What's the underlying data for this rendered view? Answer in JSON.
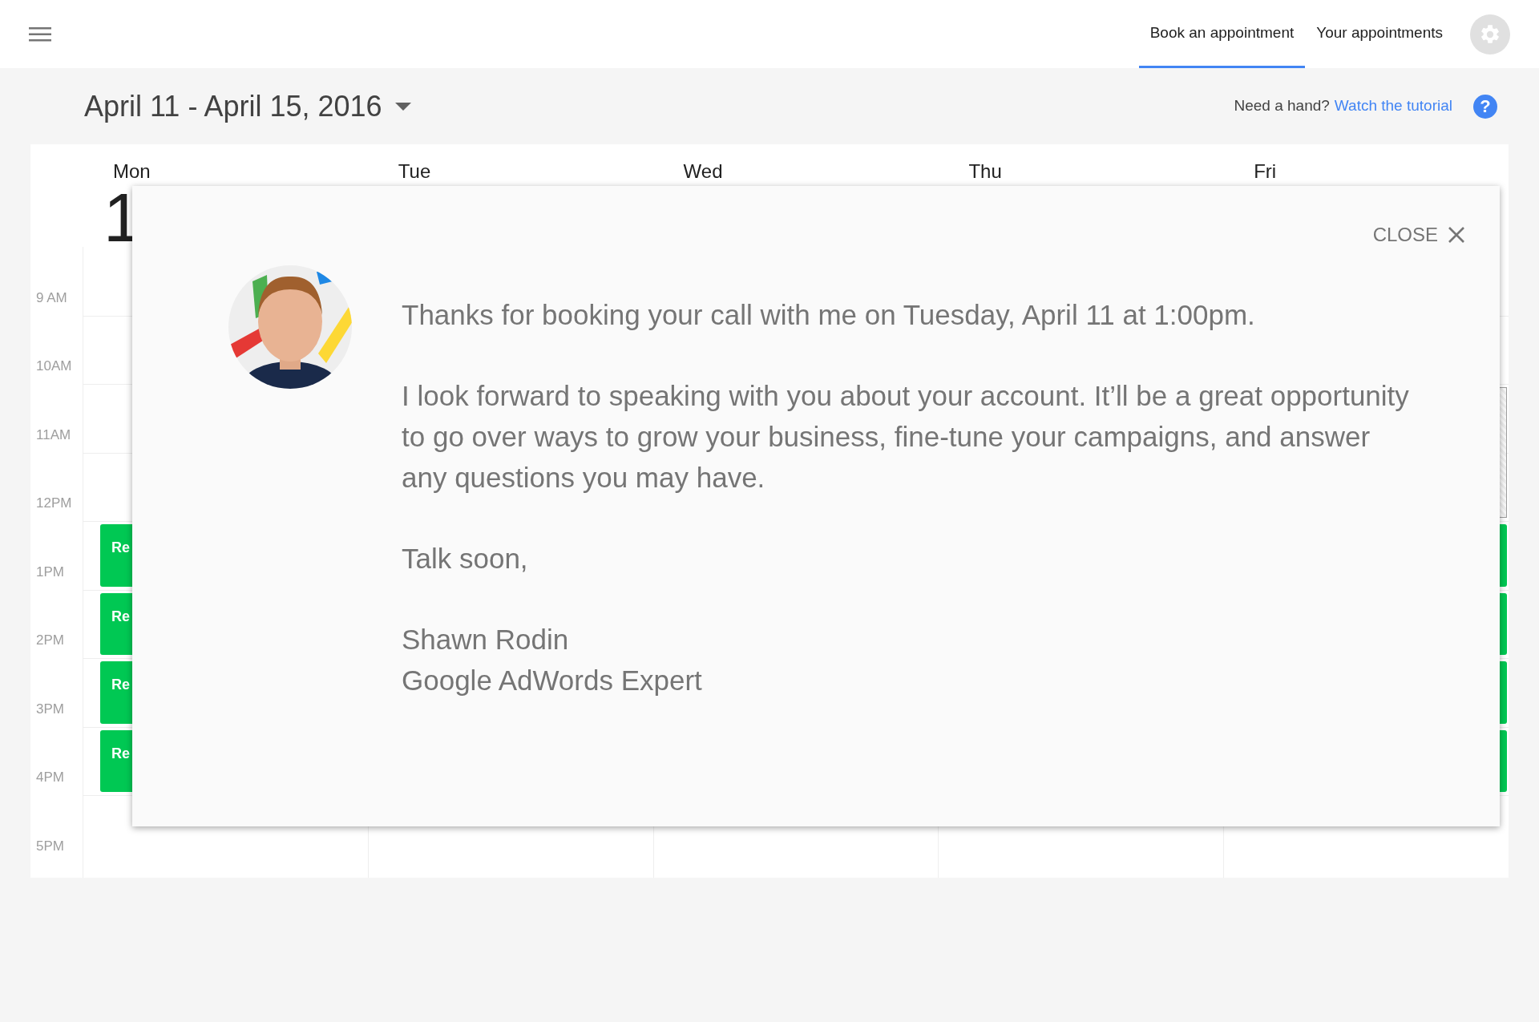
{
  "tabs": [
    {
      "label": "Book an appointment",
      "selected": true
    },
    {
      "label": "Your appointments",
      "selected": false
    }
  ],
  "date_range": "April 11 - April 15, 2016",
  "help": {
    "text": "Need a hand?",
    "link": "Watch the tutorial",
    "icon": "?"
  },
  "calendar": {
    "days": [
      {
        "name": "Mon",
        "date": "1",
        "slots": [
          {
            "kind": "empty"
          },
          {
            "kind": "empty"
          },
          {
            "kind": "empty"
          },
          {
            "kind": "empty"
          },
          {
            "kind": "event",
            "label": "Re"
          },
          {
            "kind": "event",
            "label": "Re"
          },
          {
            "kind": "event",
            "label": "Re"
          },
          {
            "kind": "event",
            "label": "Re"
          },
          {
            "kind": "empty"
          }
        ]
      },
      {
        "name": "Tue"
      },
      {
        "name": "Wed"
      },
      {
        "name": "Thu"
      },
      {
        "name": "Fri",
        "slots": [
          {
            "kind": "empty"
          },
          {
            "kind": "empty"
          },
          {
            "kind": "blocked"
          },
          {
            "kind": "blocked"
          },
          {
            "kind": "event"
          },
          {
            "kind": "event"
          },
          {
            "kind": "event"
          },
          {
            "kind": "event"
          },
          {
            "kind": "empty"
          }
        ]
      }
    ],
    "hours": [
      "9 AM",
      "10AM",
      "11AM",
      "12PM",
      "1PM",
      "2PM",
      "3PM",
      "4PM",
      "5PM"
    ]
  },
  "dialog": {
    "close": "CLOSE",
    "avatar": {
      "kind": "picture"
    },
    "paragraphs": [
      [
        "Thanks for booking your call with me on Tuesday, April 11 at 1:00pm."
      ],
      [
        "I look forward to speaking with you about your account. It’ll be a great opportunity to go over ways to grow your business, fine-tune your campaigns, and answer any questions you may have."
      ],
      [
        "Talk soon,"
      ],
      [
        "Shawn Rodin",
        "Google AdWords Expert"
      ]
    ]
  }
}
